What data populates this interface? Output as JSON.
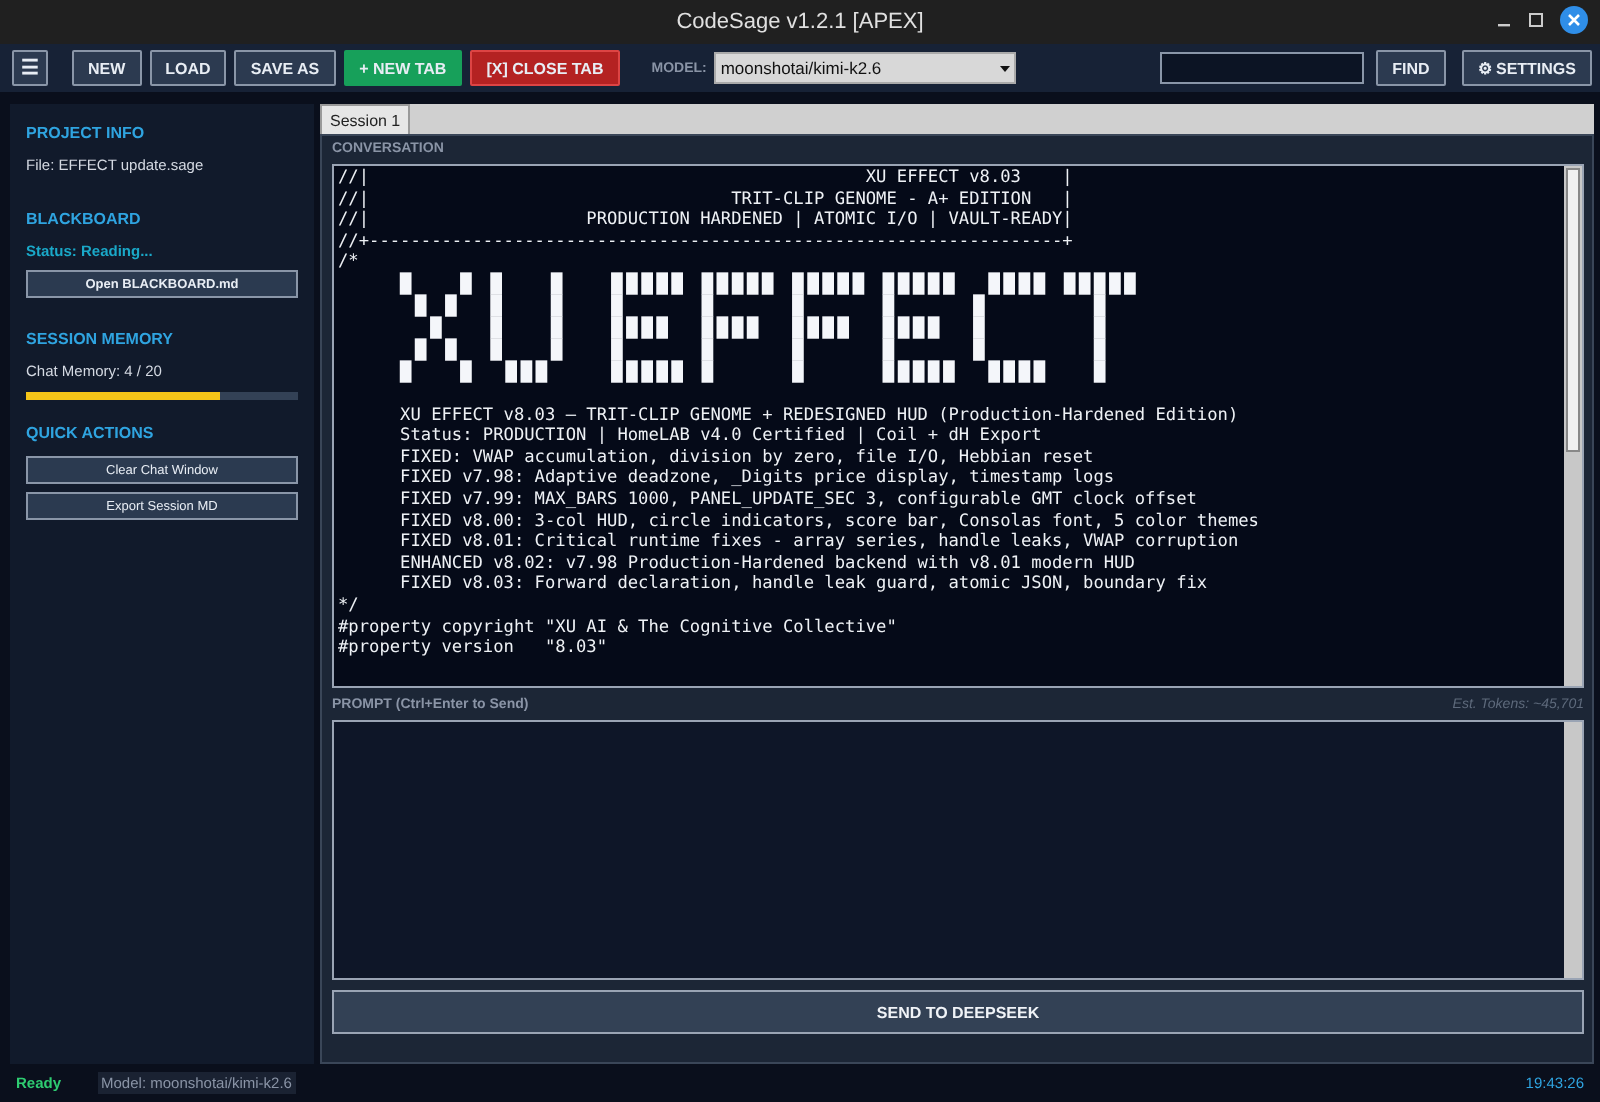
{
  "window": {
    "title": "CodeSage v1.2.1 [APEX]"
  },
  "toolbar": {
    "menu_button": "☰",
    "buttons": [
      {
        "label": "NEW",
        "kind": "plain"
      },
      {
        "label": "LOAD",
        "kind": "plain"
      },
      {
        "label": "SAVE AS",
        "kind": "plain"
      },
      {
        "label": "+ NEW TAB",
        "kind": "add"
      },
      {
        "label": "[X] CLOSE TAB",
        "kind": "danger"
      }
    ],
    "model_label": "MODEL:",
    "model_value": "moonshotai/kimi-k2.6",
    "find_button": "FIND",
    "settings_button": "⚙ SETTINGS"
  },
  "sidebar": [
    {
      "kind": "info",
      "title": "PROJECT INFO",
      "text": "File: EFFECT update.sage"
    },
    {
      "kind": "status",
      "title": "BLACKBOARD",
      "status": "Status: Reading...",
      "button": "Open BLACKBOARD.md"
    },
    {
      "kind": "meter",
      "title": "SESSION MEMORY",
      "label": "Chat Memory: 4 / 20",
      "level": 0.71
    },
    {
      "kind": "actions",
      "title": "QUICK ACTIONS",
      "buttons": [
        "Clear Chat Window",
        "Export Session MD"
      ]
    }
  ],
  "tabs": [
    {
      "label": "Session 1",
      "selected": true
    }
  ],
  "conversation": {
    "title": "CONVERSATION",
    "lines": [
      {
        "kind": "code",
        "text": "//|                                                XU EFFECT v8.03    |"
      },
      {
        "kind": "code",
        "text": "//|                                   TRIT-CLIP GENOME - A+ EDITION   |"
      },
      {
        "kind": "code",
        "text": "//|                     PRODUCTION HARDENED | ATOMIC I/O | VAULT-READY|"
      },
      {
        "kind": "code",
        "text": "//+-------------------------------------------------------------------+"
      },
      {
        "kind": "code",
        "text": "/*"
      },
      {
        "kind": "banner",
        "text": "█   █ █   █   █████ █████ █████ █████  ████ █████"
      },
      {
        "kind": "banner",
        "text": " █ █  █   █   █     █     █     █     █       █"
      },
      {
        "kind": "banner",
        "text": "  █   █   █   ████  ████  ████  ████  █       █"
      },
      {
        "kind": "banner",
        "text": " █ █  █   █   █     █     █     █     █       █"
      },
      {
        "kind": "banner",
        "text": "█   █  ███    █████ █     █     █████  ████   █"
      },
      {
        "kind": "blank"
      },
      {
        "kind": "code",
        "text": "      XU EFFECT v8.03 — TRIT-CLIP GENOME + REDESIGNED HUD (Production-Hardened Edition)"
      },
      {
        "kind": "code",
        "text": "      Status: PRODUCTION | HomeLAB v4.0 Certified | Coil + dH Export"
      },
      {
        "kind": "code",
        "text": "      FIXED: VWAP accumulation, division by zero, file I/O, Hebbian reset"
      },
      {
        "kind": "code",
        "text": "      FIXED v7.98: Adaptive deadzone, _Digits price display, timestamp logs"
      },
      {
        "kind": "code",
        "text": "      FIXED v7.99: MAX_BARS 1000, PANEL_UPDATE_SEC 3, configurable GMT clock offset"
      },
      {
        "kind": "code",
        "text": "      FIXED v8.00: 3-col HUD, circle indicators, score bar, Consolas font, 5 color themes"
      },
      {
        "kind": "code",
        "text": "      FIXED v8.01: Critical runtime fixes - array series, handle leaks, VWAP corruption"
      },
      {
        "kind": "code",
        "text": "      ENHANCED v8.02: v7.98 Production-Hardened backend with v8.01 modern HUD"
      },
      {
        "kind": "code",
        "text": "      FIXED v8.03: Forward declaration, handle leak guard, atomic JSON, boundary fix"
      },
      {
        "kind": "code",
        "text": "*/"
      },
      {
        "kind": "code",
        "text": "#property copyright \"XU AI & The Cognitive Collective\""
      },
      {
        "kind": "code",
        "text": "#property version   \"8.03\""
      }
    ]
  },
  "prompt": {
    "title": "PROMPT (Ctrl+Enter to Send)",
    "tokens": "Est. Tokens: ~45,701",
    "send_button": "SEND TO DEEPSEEK"
  },
  "status_bar": {
    "state": "Ready",
    "model": "Model: moonshotai/kimi-k2.6",
    "time": "19:43:26"
  }
}
